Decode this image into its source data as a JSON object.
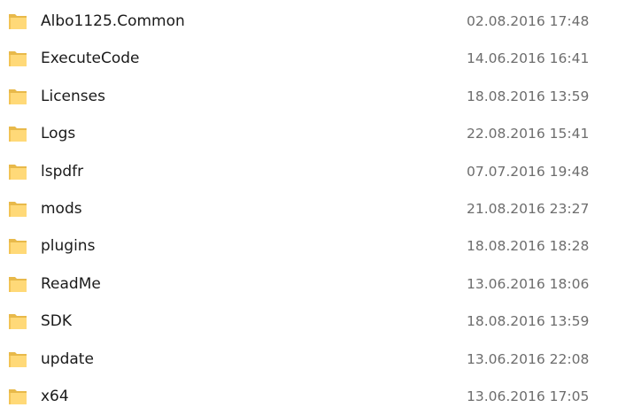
{
  "folders": [
    {
      "name": "Albo1125.Common",
      "date_modified": "02.08.2016 17:48",
      "icon": "folder-icon"
    },
    {
      "name": "ExecuteCode",
      "date_modified": "14.06.2016 16:41",
      "icon": "folder-icon"
    },
    {
      "name": "Licenses",
      "date_modified": "18.08.2016 13:59",
      "icon": "folder-icon"
    },
    {
      "name": "Logs",
      "date_modified": "22.08.2016 15:41",
      "icon": "folder-icon"
    },
    {
      "name": "lspdfr",
      "date_modified": "07.07.2016 19:48",
      "icon": "folder-icon"
    },
    {
      "name": "mods",
      "date_modified": "21.08.2016 23:27",
      "icon": "folder-icon"
    },
    {
      "name": "plugins",
      "date_modified": "18.08.2016 18:28",
      "icon": "folder-icon"
    },
    {
      "name": "ReadMe",
      "date_modified": "13.06.2016 18:06",
      "icon": "folder-icon"
    },
    {
      "name": "SDK",
      "date_modified": "18.08.2016 13:59",
      "icon": "folder-icon"
    },
    {
      "name": "update",
      "date_modified": "13.06.2016 22:08",
      "icon": "folder-icon"
    },
    {
      "name": "x64",
      "date_modified": "13.06.2016 17:05",
      "icon": "folder-icon"
    }
  ],
  "colors": {
    "folder_back": "#e8b94a",
    "folder_front": "#ffd978",
    "name_text": "#1a1a1a",
    "date_text": "#6d6d6d",
    "background": "#ffffff"
  }
}
